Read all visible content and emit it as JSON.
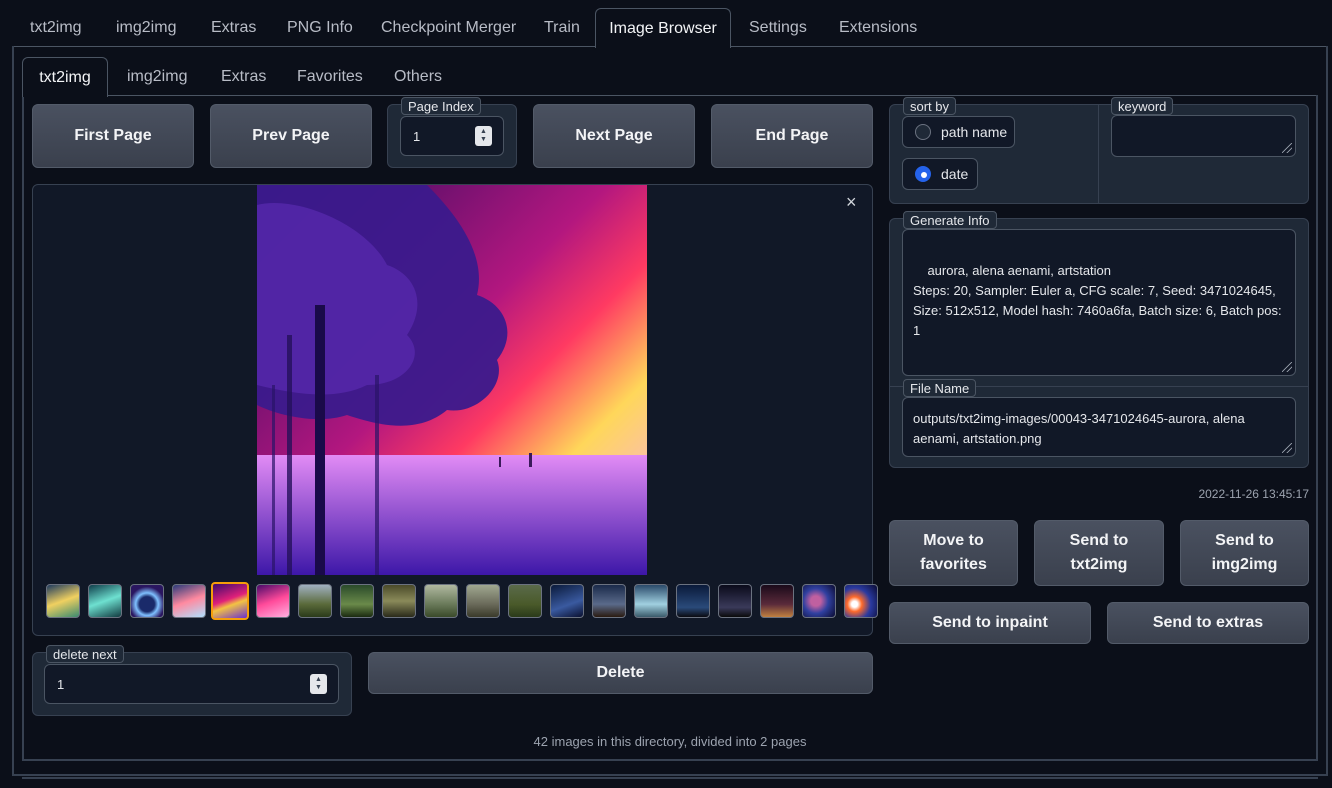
{
  "main_tabs": [
    "txt2img",
    "img2img",
    "Extras",
    "PNG Info",
    "Checkpoint Merger",
    "Train",
    "Image Browser",
    "Settings",
    "Extensions"
  ],
  "sub_tabs": [
    "txt2img",
    "img2img",
    "Extras",
    "Favorites",
    "Others"
  ],
  "nav": {
    "first": "First Page",
    "prev": "Prev Page",
    "next": "Next Page",
    "end": "End Page",
    "page_index_label": "Page Index",
    "page_index_value": "1"
  },
  "gallery": {
    "close": "×",
    "selected_index": 4,
    "thumb_count": 20
  },
  "sort": {
    "label": "sort by",
    "options": [
      "path name",
      "date"
    ],
    "selected": "date"
  },
  "keyword": {
    "label": "keyword",
    "value": ""
  },
  "generate_info": {
    "label": "Generate Info",
    "text": "aurora, alena aenami, artstation\nSteps: 20, Sampler: Euler a, CFG scale: 7, Seed: 3471024645, Size: 512x512, Model hash: 7460a6fa, Batch size: 6, Batch pos: 1"
  },
  "file_name": {
    "label": "File Name",
    "value": "outputs/txt2img-images/00043-3471024645-aurora, alena aenami, artstation.png"
  },
  "timestamp": "2022-11-26 13:45:17",
  "actions": {
    "move_fav": "Move to favorites",
    "send_txt2img": "Send to txt2img",
    "send_img2img": "Send to img2img",
    "send_inpaint": "Send to inpaint",
    "send_extras": "Send to extras"
  },
  "delete": {
    "label": "delete next",
    "value": "1",
    "button": "Delete"
  },
  "status": "42 images in this directory, divided into 2 pages",
  "colors": {
    "background": "#0b0f19",
    "panel": "#1f2937",
    "selected_thumb_border": "#f59e0b",
    "radio_selected": "#2563eb"
  }
}
